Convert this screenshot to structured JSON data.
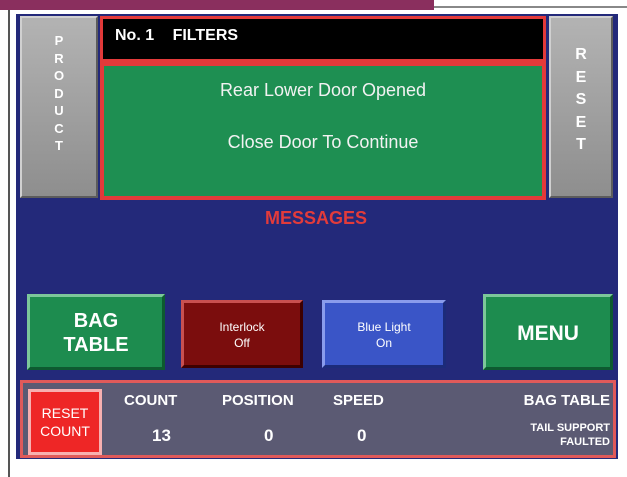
{
  "product_button": {
    "label": "PRODUCT"
  },
  "reset_button": {
    "label": "RESET"
  },
  "header": {
    "number": "No. 1",
    "title": "FILTERS"
  },
  "message_box": {
    "line1": "Rear Lower Door Opened",
    "line2": "Close Door To Continue"
  },
  "messages_label": "MESSAGES",
  "buttons": {
    "bag_table_line1": "BAG",
    "bag_table_line2": "TABLE",
    "interlock_line1": "Interlock",
    "interlock_line2": "Off",
    "blue_light_line1": "Blue Light",
    "blue_light_line2": "On",
    "menu": "MENU"
  },
  "status": {
    "reset_count_line1": "RESET",
    "reset_count_line2": "COUNT",
    "count_label": "COUNT",
    "count_value": "13",
    "position_label": "POSITION",
    "position_value": "0",
    "speed_label": "SPEED",
    "speed_value": "0",
    "bag_table_label": "BAG TABLE",
    "bag_table_status_line1": "TAIL SUPPORT",
    "bag_table_status_line2": "FAULTED"
  },
  "colors": {
    "panel_background": "#23297a",
    "alert_border": "#e33a3a",
    "message_green": "#1e8f52",
    "messages_text": "#e23b3b",
    "interlock_red": "#7b0d0d",
    "blue_light": "#3a55c7",
    "reset_count_red": "#ee2626"
  }
}
